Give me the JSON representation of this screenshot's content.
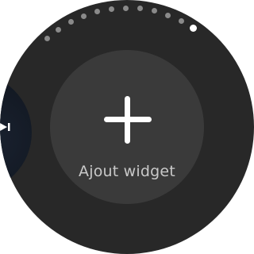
{
  "page_indicator": {
    "count": 12,
    "active_index": 11
  },
  "prev_widget": {
    "icon": "media-control-icon"
  },
  "add_widget": {
    "icon": "plus-icon",
    "label": "Ajout widget"
  },
  "colors": {
    "face_background": "#282828",
    "add_widget_background": "#3a3a3a",
    "dot_inactive": "#8a8a8a",
    "dot_active": "#ffffff",
    "label_text": "#c9c9c9"
  }
}
